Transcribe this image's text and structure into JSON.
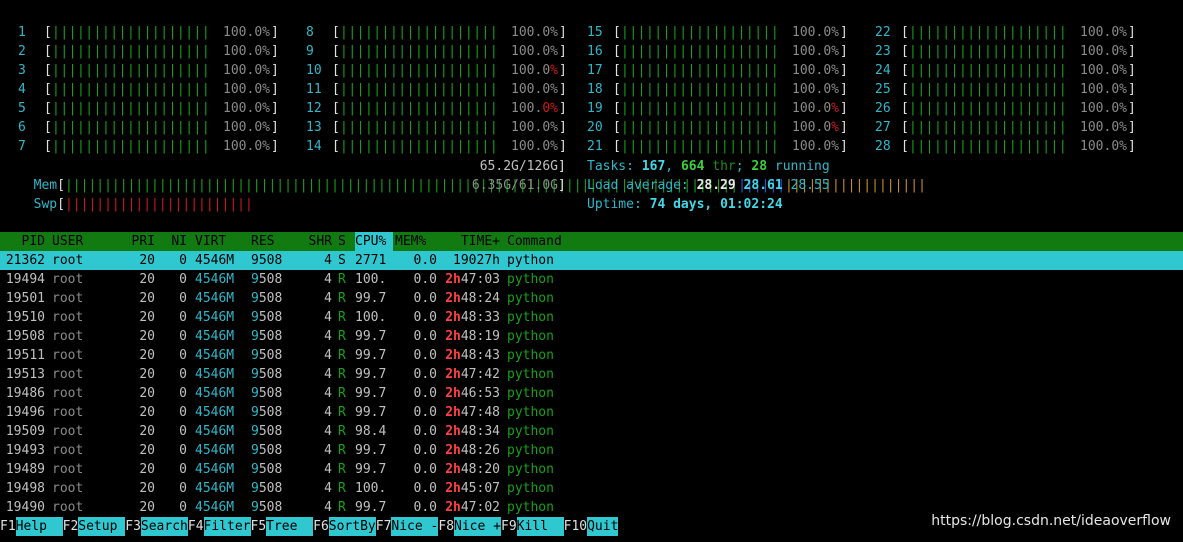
{
  "cpus": [
    {
      "id": "1",
      "pct": "100.0%",
      "pct_main": "100.0",
      "pct_sign": "%",
      "red": false
    },
    {
      "id": "2",
      "pct": "100.0%",
      "pct_main": "100.0",
      "pct_sign": "%",
      "red": false
    },
    {
      "id": "3",
      "pct": "100.0%",
      "pct_main": "100.0",
      "pct_sign": "%",
      "red": false
    },
    {
      "id": "4",
      "pct": "100.0%",
      "pct_main": "100.0",
      "pct_sign": "%",
      "red": false
    },
    {
      "id": "5",
      "pct": "100.0%",
      "pct_main": "100.0",
      "pct_sign": "%",
      "red": false
    },
    {
      "id": "6",
      "pct": "100.0%",
      "pct_main": "100.0",
      "pct_sign": "%",
      "red": false
    },
    {
      "id": "7",
      "pct": "100.0%",
      "pct_main": "100.0",
      "pct_sign": "%",
      "red": false
    },
    {
      "id": "8",
      "pct": "100.0%",
      "pct_main": "100.0",
      "pct_sign": "%",
      "red": false
    },
    {
      "id": "9",
      "pct": "100.0%",
      "pct_main": "100.0",
      "pct_sign": "%",
      "red": false
    },
    {
      "id": "10",
      "pct": "100.0%",
      "pct_main": "100.0",
      "pct_sign": "%",
      "red": true
    },
    {
      "id": "11",
      "pct": "100.0%",
      "pct_main": "100.0",
      "pct_sign": "%",
      "red": false
    },
    {
      "id": "12",
      "pct": "100.0%",
      "pct_main": "100.0",
      "pct_sign": "%",
      "red": true
    },
    {
      "id": "13",
      "pct": "100.0%",
      "pct_main": "100.0",
      "pct_sign": "%",
      "red": false
    },
    {
      "id": "14",
      "pct": "100.0%",
      "pct_main": "100.0",
      "pct_sign": "%",
      "red": false
    },
    {
      "id": "15",
      "pct": "100.0%",
      "pct_main": "100.0",
      "pct_sign": "%",
      "red": false
    },
    {
      "id": "16",
      "pct": "100.0%",
      "pct_main": "100.0",
      "pct_sign": "%",
      "red": false
    },
    {
      "id": "17",
      "pct": "100.0%",
      "pct_main": "100.0",
      "pct_sign": "%",
      "red": false
    },
    {
      "id": "18",
      "pct": "100.0%",
      "pct_main": "100.0",
      "pct_sign": "%",
      "red": false
    },
    {
      "id": "19",
      "pct": "100.0%",
      "pct_main": "100.0",
      "pct_sign": "%",
      "red": true
    },
    {
      "id": "20",
      "pct": "100.0%",
      "pct_main": "100.0",
      "pct_sign": "%",
      "red": true
    },
    {
      "id": "21",
      "pct": "100.0%",
      "pct_main": "100.0",
      "pct_sign": "%",
      "red": false
    },
    {
      "id": "22",
      "pct": "100.0%",
      "pct_main": "100.0",
      "pct_sign": "%",
      "red": false
    },
    {
      "id": "23",
      "pct": "100.0%",
      "pct_main": "100.0",
      "pct_sign": "%",
      "red": false
    },
    {
      "id": "24",
      "pct": "100.0%",
      "pct_main": "100.0",
      "pct_sign": "%",
      "red": false
    },
    {
      "id": "25",
      "pct": "100.0%",
      "pct_main": "100.0",
      "pct_sign": "%",
      "red": false
    },
    {
      "id": "26",
      "pct": "100.0%",
      "pct_main": "100.0",
      "pct_sign": "%",
      "red": false
    },
    {
      "id": "27",
      "pct": "100.0%",
      "pct_main": "100.0",
      "pct_sign": "%",
      "red": false
    },
    {
      "id": "28",
      "pct": "100.0%",
      "pct_main": "100.0",
      "pct_sign": "%",
      "red": false
    }
  ],
  "mem": {
    "label": "Mem",
    "value": "65.2G/126G"
  },
  "swp": {
    "label": "Swp",
    "value": "6.35G/61.0G"
  },
  "tasks": {
    "label": "Tasks: ",
    "count": "167",
    "sep": ", ",
    "thr": "664",
    "thr_label": " thr",
    "sep2": "; ",
    "running": "28",
    "running_label": " running"
  },
  "load": {
    "label": "Load average: ",
    "l1": "28.29",
    "l5": "28.61",
    "l15": "28.55"
  },
  "uptime": {
    "label": "Uptime: ",
    "value": "74 days, 01:02:24"
  },
  "columns": [
    "PID",
    "USER",
    "PRI",
    "NI",
    "VIRT",
    "RES",
    "SHR",
    "S",
    "CPU%",
    "MEM%",
    "TIME+",
    "Command"
  ],
  "processes": [
    {
      "pid": "21362",
      "user": "root",
      "pri": "20",
      "ni": "0",
      "virt": "4546M",
      "res": "9508",
      "shr": "4",
      "s": "S",
      "cpu": "2771",
      "mem": "0.0",
      "time": "19027h",
      "cmd": "python",
      "selected": true
    },
    {
      "pid": "19494",
      "user": "root",
      "pri": "20",
      "ni": "0",
      "virt": "4546M",
      "res": "9508",
      "shr": "4",
      "s": "R",
      "cpu": "100.",
      "mem": "0.0",
      "time_h": "2h",
      "time_m": "47:03",
      "cmd": "python"
    },
    {
      "pid": "19501",
      "user": "root",
      "pri": "20",
      "ni": "0",
      "virt": "4546M",
      "res": "9508",
      "shr": "4",
      "s": "R",
      "cpu": "99.7",
      "mem": "0.0",
      "time_h": "2h",
      "time_m": "48:24",
      "cmd": "python"
    },
    {
      "pid": "19510",
      "user": "root",
      "pri": "20",
      "ni": "0",
      "virt": "4546M",
      "res": "9508",
      "shr": "4",
      "s": "R",
      "cpu": "100.",
      "mem": "0.0",
      "time_h": "2h",
      "time_m": "48:33",
      "cmd": "python"
    },
    {
      "pid": "19508",
      "user": "root",
      "pri": "20",
      "ni": "0",
      "virt": "4546M",
      "res": "9508",
      "shr": "4",
      "s": "R",
      "cpu": "99.7",
      "mem": "0.0",
      "time_h": "2h",
      "time_m": "48:19",
      "cmd": "python"
    },
    {
      "pid": "19511",
      "user": "root",
      "pri": "20",
      "ni": "0",
      "virt": "4546M",
      "res": "9508",
      "shr": "4",
      "s": "R",
      "cpu": "99.7",
      "mem": "0.0",
      "time_h": "2h",
      "time_m": "48:43",
      "cmd": "python"
    },
    {
      "pid": "19513",
      "user": "root",
      "pri": "20",
      "ni": "0",
      "virt": "4546M",
      "res": "9508",
      "shr": "4",
      "s": "R",
      "cpu": "99.7",
      "mem": "0.0",
      "time_h": "2h",
      "time_m": "47:42",
      "cmd": "python"
    },
    {
      "pid": "19486",
      "user": "root",
      "pri": "20",
      "ni": "0",
      "virt": "4546M",
      "res": "9508",
      "shr": "4",
      "s": "R",
      "cpu": "99.7",
      "mem": "0.0",
      "time_h": "2h",
      "time_m": "46:53",
      "cmd": "python"
    },
    {
      "pid": "19496",
      "user": "root",
      "pri": "20",
      "ni": "0",
      "virt": "4546M",
      "res": "9508",
      "shr": "4",
      "s": "R",
      "cpu": "99.7",
      "mem": "0.0",
      "time_h": "2h",
      "time_m": "47:48",
      "cmd": "python"
    },
    {
      "pid": "19509",
      "user": "root",
      "pri": "20",
      "ni": "0",
      "virt": "4546M",
      "res": "9508",
      "shr": "4",
      "s": "R",
      "cpu": "98.4",
      "mem": "0.0",
      "time_h": "2h",
      "time_m": "48:34",
      "cmd": "python"
    },
    {
      "pid": "19493",
      "user": "root",
      "pri": "20",
      "ni": "0",
      "virt": "4546M",
      "res": "9508",
      "shr": "4",
      "s": "R",
      "cpu": "99.7",
      "mem": "0.0",
      "time_h": "2h",
      "time_m": "48:26",
      "cmd": "python"
    },
    {
      "pid": "19489",
      "user": "root",
      "pri": "20",
      "ni": "0",
      "virt": "4546M",
      "res": "9508",
      "shr": "4",
      "s": "R",
      "cpu": "99.7",
      "mem": "0.0",
      "time_h": "2h",
      "time_m": "48:20",
      "cmd": "python"
    },
    {
      "pid": "19498",
      "user": "root",
      "pri": "20",
      "ni": "0",
      "virt": "4546M",
      "res": "9508",
      "shr": "4",
      "s": "R",
      "cpu": "100.",
      "mem": "0.0",
      "time_h": "2h",
      "time_m": "45:07",
      "cmd": "python"
    },
    {
      "pid": "19490",
      "user": "root",
      "pri": "20",
      "ni": "0",
      "virt": "4546M",
      "res": "9508",
      "shr": "4",
      "s": "R",
      "cpu": "99.7",
      "mem": "0.0",
      "time_h": "2h",
      "time_m": "47:02",
      "cmd": "python"
    }
  ],
  "fkeys": [
    {
      "key": "F1",
      "label": "Help  "
    },
    {
      "key": "F2",
      "label": "Setup "
    },
    {
      "key": "F3",
      "label": "Search"
    },
    {
      "key": "F4",
      "label": "Filter"
    },
    {
      "key": "F5",
      "label": "Tree  "
    },
    {
      "key": "F6",
      "label": "SortBy"
    },
    {
      "key": "F7",
      "label": "Nice -"
    },
    {
      "key": "F8",
      "label": "Nice +"
    },
    {
      "key": "F9",
      "label": "Kill  "
    },
    {
      "key": "F10",
      "label": "Quit"
    }
  ],
  "watermark": "https://blog.csdn.net/ideaoverflow",
  "colors": {
    "accent": "#2fc8d0",
    "header_bg": "#117a11",
    "bar": "#16a016",
    "time_hours": "#ff4040"
  }
}
